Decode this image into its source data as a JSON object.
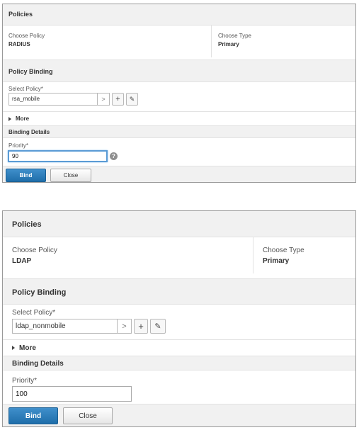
{
  "panels": [
    {
      "header_title": "Policies",
      "choose_policy_label": "Choose Policy",
      "choose_policy_value": "RADIUS",
      "choose_type_label": "Choose Type",
      "choose_type_value": "Primary",
      "section_title": "Policy Binding",
      "select_policy_label": "Select Policy*",
      "select_policy_value": "rsa_mobile",
      "arrow_glyph": ">",
      "add_glyph": "+",
      "edit_glyph": "✎",
      "more_label": "More",
      "binding_details_label": "Binding Details",
      "priority_label": "Priority*",
      "priority_value": "90",
      "help_glyph": "?",
      "bind_label": "Bind",
      "close_label": "Close"
    },
    {
      "header_title": "Policies",
      "choose_policy_label": "Choose Policy",
      "choose_policy_value": "LDAP",
      "choose_type_label": "Choose Type",
      "choose_type_value": "Primary",
      "section_title": "Policy Binding",
      "select_policy_label": "Select Policy*",
      "select_policy_value": "ldap_nonmobile",
      "arrow_glyph": ">",
      "add_glyph": "+",
      "edit_glyph": "✎",
      "more_label": "More",
      "binding_details_label": "Binding Details",
      "priority_label": "Priority*",
      "priority_value": "100",
      "bind_label": "Bind",
      "close_label": "Close"
    }
  ],
  "colors": {
    "primary_button": "#2a7dbd",
    "focus_border": "#5a9bd5",
    "section_background": "#f1f1f1"
  }
}
